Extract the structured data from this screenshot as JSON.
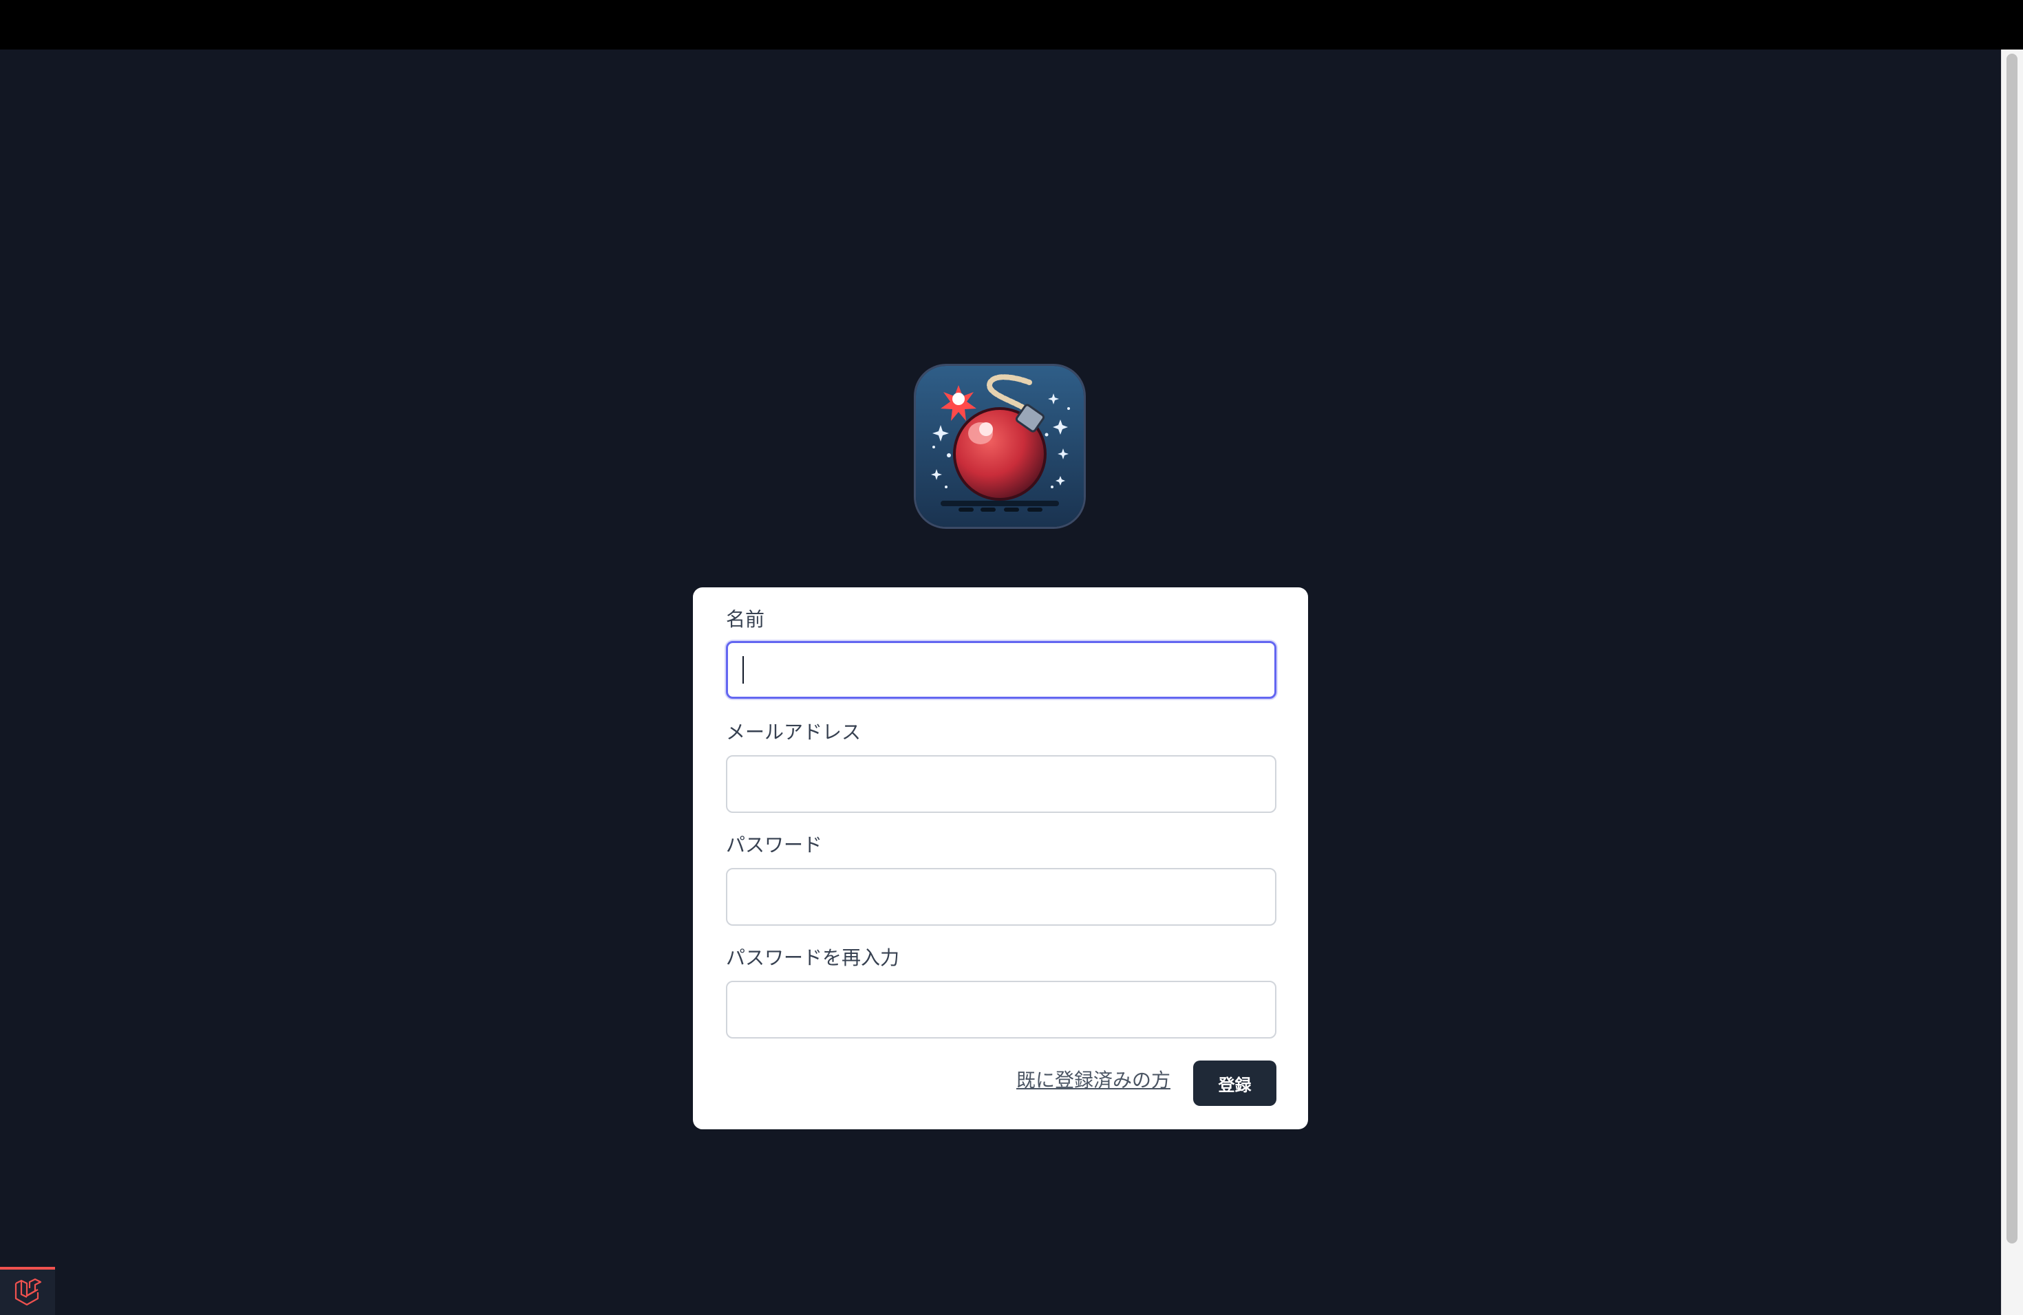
{
  "form": {
    "name_label": "名前",
    "name_value": "",
    "email_label": "メールアドレス",
    "email_value": "",
    "password_label": "パスワード",
    "password_value": "",
    "password_confirm_label": "パスワードを再入力",
    "password_confirm_value": "",
    "login_link": "既に登録済みの方",
    "submit_label": "登録"
  },
  "logo": {
    "icon": "bomb-icon"
  },
  "debugbar": {
    "icon": "laravel-icon"
  },
  "colors": {
    "background": "#121723",
    "card": "#ffffff",
    "focus_ring": "#6366f1",
    "button": "#1f2937",
    "debug_accent": "#f0524f"
  }
}
